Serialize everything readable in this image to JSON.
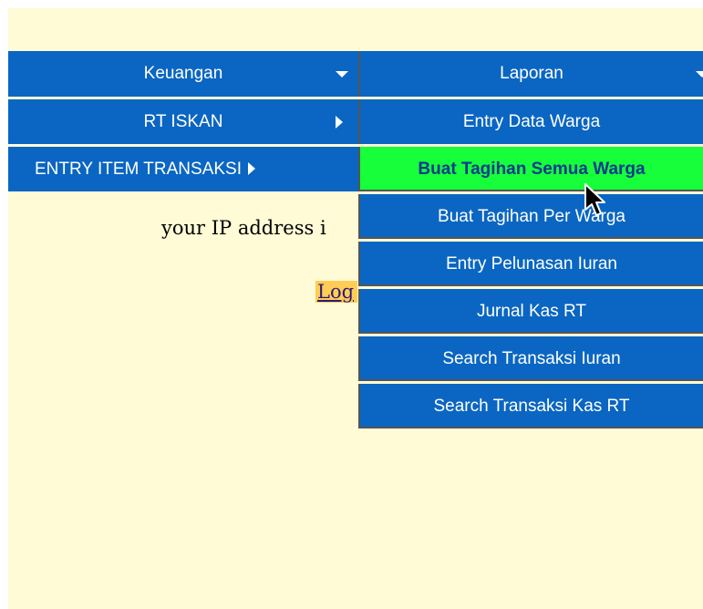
{
  "menu": {
    "keuangan": "Keuangan",
    "rt_iskan": "RT ISKAN",
    "entry_item": "ENTRY ITEM TRANSAKSI"
  },
  "laporan": {
    "header": "Laporan",
    "items": [
      "Entry Data Warga",
      "Buat Tagihan Semua Warga",
      "Buat Tagihan Per Warga",
      "Entry Pelunasan Iuran",
      "Jurnal Kas RT",
      "Search Transaksi Iuran",
      "Search Transaksi Kas RT"
    ],
    "highlighted_index": 1
  },
  "body": {
    "ip_text": "your IP address i",
    "logout_text": "Log"
  },
  "colors": {
    "page_bg": "#fffbd6",
    "menu_bg": "#0a66c2",
    "highlight_bg": "#16ff3a",
    "highlight_text": "#0b3a8e",
    "logout_bg": "#ffcc55"
  },
  "icons": {
    "dropdown": "caret-down-icon",
    "submenu": "caret-right-icon",
    "cursor": "mouse-pointer-icon"
  }
}
